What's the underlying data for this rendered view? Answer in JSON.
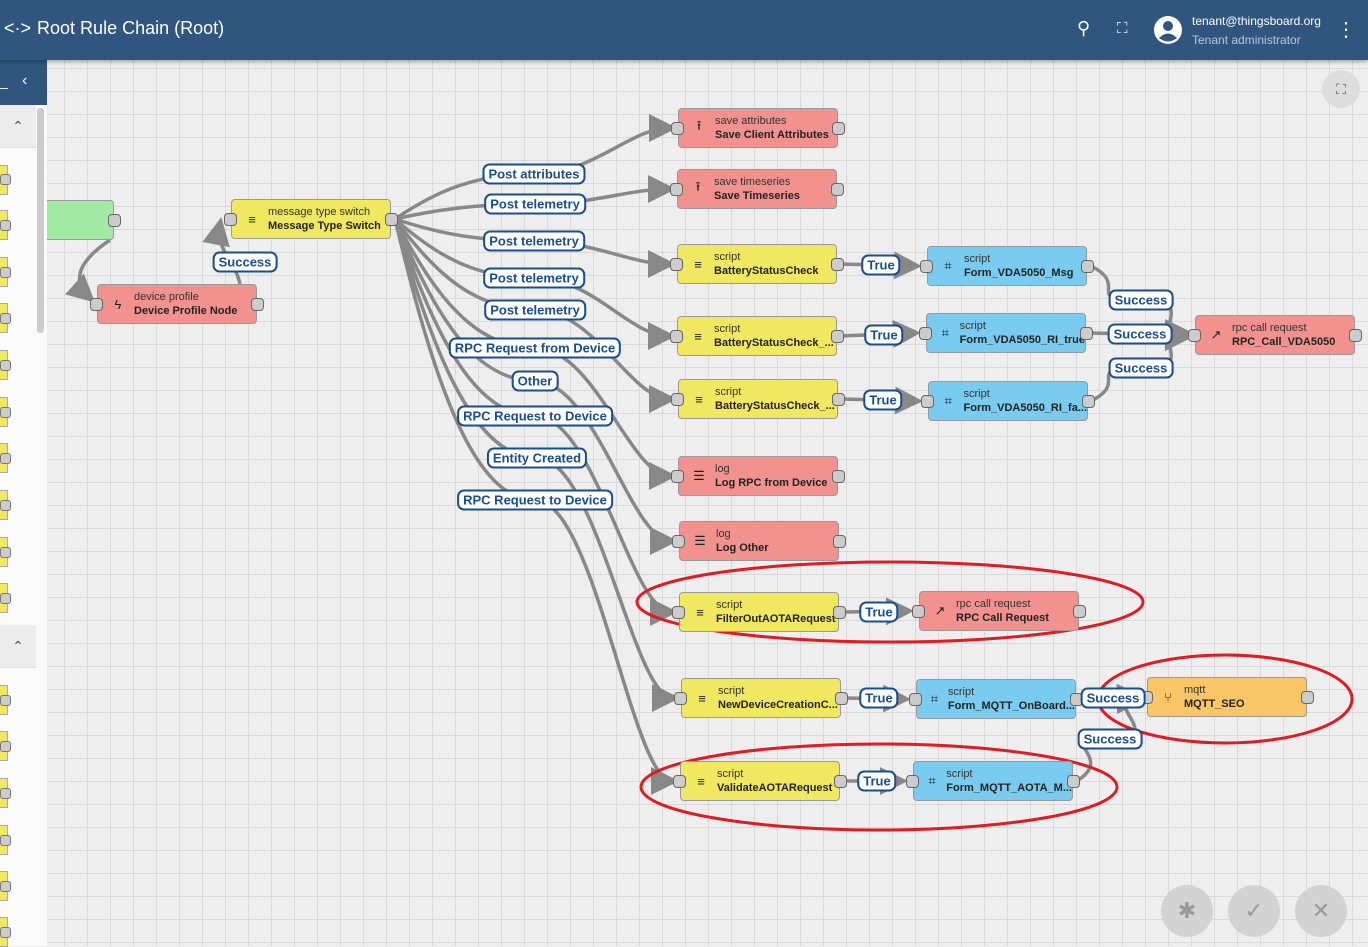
{
  "header": {
    "title": "Root Rule Chain (Root)",
    "user_email": "tenant@thingsboard.org",
    "user_role": "Tenant administrator",
    "icons": [
      "rule-chain-icon",
      "search-icon",
      "fullscreen-icon",
      "account-circle-icon",
      "more-vert-icon"
    ]
  },
  "nodes": {
    "device_profile": {
      "type": "device profile",
      "name": "Device Profile Node"
    },
    "switch": {
      "type": "message type switch",
      "name": "Message Type Switch"
    },
    "save_attr": {
      "type": "save attributes",
      "name": "Save Client Attributes"
    },
    "save_ts": {
      "type": "save timeseries",
      "name": "Save Timeseries"
    },
    "bat1": {
      "type": "script",
      "name": "BatteryStatusCheck"
    },
    "bat2": {
      "type": "script",
      "name": "BatteryStatusCheck_..."
    },
    "bat3": {
      "type": "script",
      "name": "BatteryStatusCheck_..."
    },
    "f1": {
      "type": "script",
      "name": "Form_VDA5050_Msg"
    },
    "f2": {
      "type": "script",
      "name": "Form_VDA5050_RI_true"
    },
    "f3": {
      "type": "script",
      "name": "Form_VDA5050_RI_fa..."
    },
    "rpc_vda": {
      "type": "rpc call request",
      "name": "RPC_Call_VDA5050"
    },
    "log_rpc": {
      "type": "log",
      "name": "Log RPC from Device"
    },
    "log_other": {
      "type": "log",
      "name": "Log Other"
    },
    "filter": {
      "type": "script",
      "name": "FilterOutAOTARequest"
    },
    "rpc_call": {
      "type": "rpc call request",
      "name": "RPC Call Request"
    },
    "newdev": {
      "type": "script",
      "name": "NewDeviceCreationC..."
    },
    "onboard": {
      "type": "script",
      "name": "Form_MQTT_OnBoard..."
    },
    "mqtt": {
      "type": "mqtt",
      "name": "MQTT_SEO"
    },
    "validate": {
      "type": "script",
      "name": "ValidateAOTARequest"
    },
    "aota": {
      "type": "script",
      "name": "Form_MQTT_AOTA_M..."
    }
  },
  "links": {
    "success": "Success",
    "post_attributes": "Post attributes",
    "post_telemetry": "Post telemetry",
    "rpc_from_device": "RPC Request from Device",
    "other": "Other",
    "rpc_to_device": "RPC Request to Device",
    "entity_created": "Entity Created",
    "true": "True"
  },
  "colors": {
    "header": "#305680",
    "filter_node": "#f1e861",
    "action_node": "#f1928f",
    "transform_node": "#79cbef",
    "external_node": "#fbc766",
    "input_node": "#a3eaa4",
    "link_label": "#1a4d8f",
    "highlight": "#e01b24"
  }
}
